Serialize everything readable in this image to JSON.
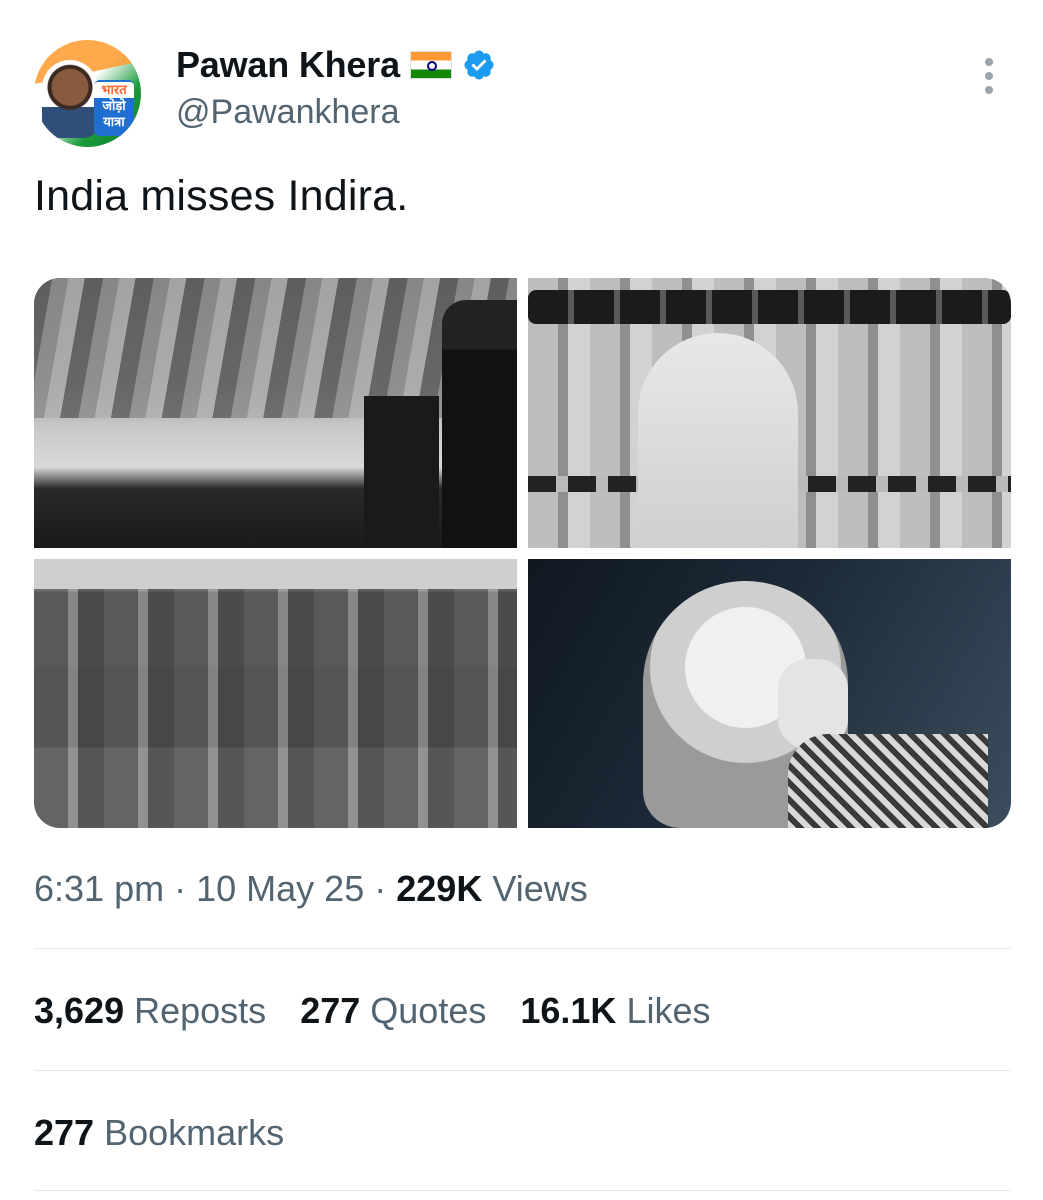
{
  "author": {
    "name": "Pawan Khera",
    "handle": "@Pawankhera",
    "flag_icon": "india-flag",
    "verified_icon": "verified-badge",
    "avatar_text": [
      "भारत",
      "जोड़ो",
      "यात्रा"
    ]
  },
  "tweet": {
    "text": "India misses Indira."
  },
  "media": [
    {
      "icon": "photo-speech-rally"
    },
    {
      "icon": "photo-guard-of-honour"
    },
    {
      "icon": "photo-soldiers-group"
    },
    {
      "icon": "photo-pointing-portrait"
    }
  ],
  "meta": {
    "time": "6:31 pm",
    "separator": "·",
    "date": "10 May 25",
    "views_count": "229K",
    "views_label": "Views"
  },
  "stats": {
    "reposts_count": "3,629",
    "reposts_label": "Reposts",
    "quotes_count": "277",
    "quotes_label": "Quotes",
    "likes_count": "16.1K",
    "likes_label": "Likes",
    "bookmarks_count": "277",
    "bookmarks_label": "Bookmarks"
  },
  "colors": {
    "verified_blue": "#1d9bf0",
    "secondary_text": "#536471",
    "primary_text": "#0f1419"
  }
}
